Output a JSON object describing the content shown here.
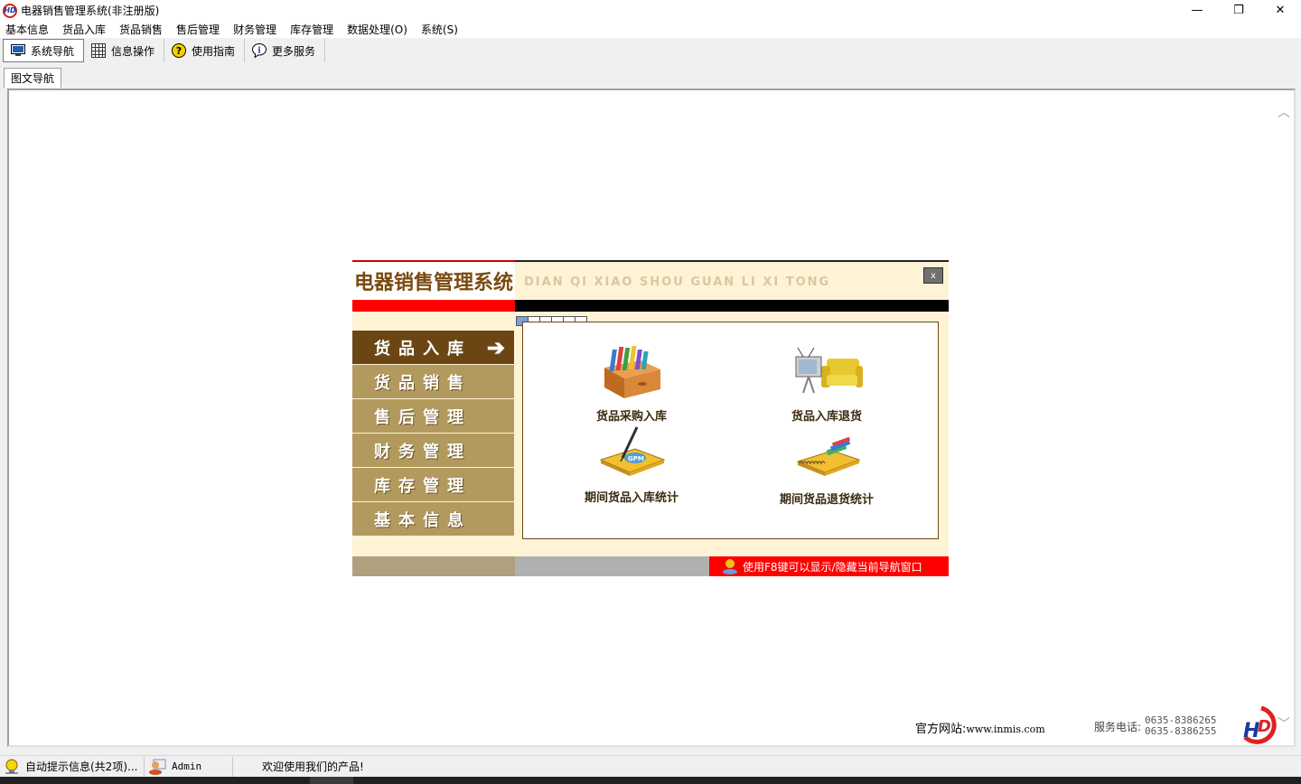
{
  "window": {
    "title": "电器销售管理系统(非注册版)",
    "minimize": "—",
    "restore": "❐",
    "close": "✕"
  },
  "menu": [
    "基本信息",
    "货品入库",
    "货品销售",
    "售后管理",
    "财务管理",
    "库存管理",
    "数据处理(O)",
    "系统(S)"
  ],
  "toolbar": {
    "items": [
      {
        "label": "系统导航",
        "icon": "monitor-icon"
      },
      {
        "label": "信息操作",
        "icon": "grid-icon"
      },
      {
        "label": "使用指南",
        "icon": "help-icon"
      },
      {
        "label": "更多服务",
        "icon": "info-icon"
      }
    ]
  },
  "tab": {
    "label": "图文导航"
  },
  "nav": {
    "title": "电器销售管理系统",
    "pinyin": "DIAN QI XIAO SHOU GUAN LI XI TONG",
    "close": "x",
    "menu": [
      {
        "label": "货品入库",
        "active": true
      },
      {
        "label": "货品销售",
        "active": false
      },
      {
        "label": "售后管理",
        "active": false
      },
      {
        "label": "财务管理",
        "active": false
      },
      {
        "label": "库存管理",
        "active": false
      },
      {
        "label": "基本信息",
        "active": false
      }
    ],
    "functions": [
      {
        "label": "货品采购入库",
        "icon": "box-icon"
      },
      {
        "label": "货品入库退货",
        "icon": "tv-sofa-icon"
      },
      {
        "label": "期间货品入库统计",
        "icon": "notebook-icon"
      },
      {
        "label": "期间货品退货统计",
        "icon": "spiral-notebook-icon"
      }
    ],
    "hint": "使用F8键可以显示/隐藏当前导航窗口"
  },
  "footer": {
    "site_label": "官方网站:",
    "site_url": "www.inmis.com",
    "phone_label": "服务电话:",
    "phone1": "0635-8386265",
    "phone2": "0635-8386255"
  },
  "statusbar": {
    "notice": "自动提示信息(共2项)...",
    "user": "Admin",
    "welcome": "欢迎使用我们的产品!"
  },
  "colors": {
    "accent_brown": "#6b4614",
    "menu_tan": "#b29a5e",
    "cream": "#fff3d6",
    "red": "#ff0000"
  }
}
